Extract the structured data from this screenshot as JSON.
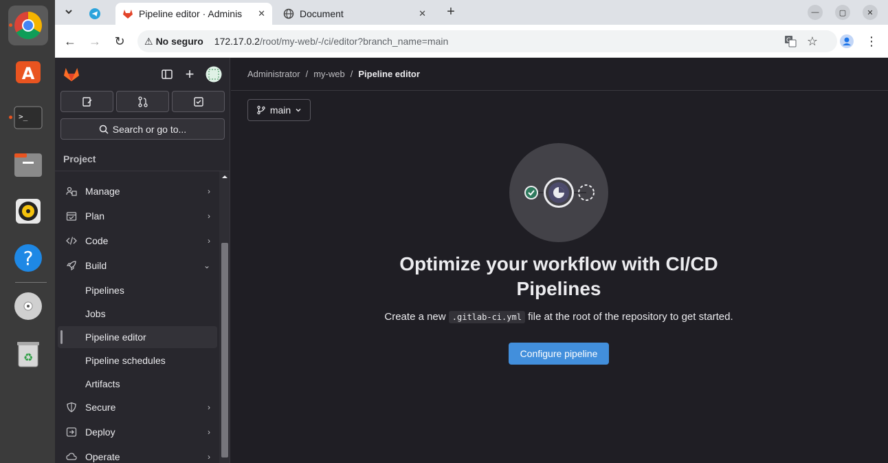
{
  "dock": {
    "apps": [
      "chrome",
      "telegram",
      "app-center",
      "terminal",
      "files",
      "rhythmbox",
      "help",
      "disc",
      "trash"
    ]
  },
  "browser": {
    "tabs": [
      {
        "title": "Pipeline editor · Adminis",
        "active": true
      },
      {
        "title": "Document",
        "active": false
      }
    ],
    "new_tab": "+",
    "omnibox": {
      "insecure_label": "No seguro",
      "url_host": "172.17.0.2",
      "url_path": "/root/my-web/-/ci/editor?branch_name=main"
    }
  },
  "sidebar": {
    "search_label": "Search or go to...",
    "section_label": "Project",
    "items": [
      {
        "label": "Manage",
        "icon": "users-icon"
      },
      {
        "label": "Plan",
        "icon": "calendar-icon"
      },
      {
        "label": "Code",
        "icon": "code-icon"
      },
      {
        "label": "Build",
        "icon": "rocket-icon"
      }
    ],
    "build_sub": [
      "Pipelines",
      "Jobs",
      "Pipeline editor",
      "Pipeline schedules",
      "Artifacts"
    ],
    "items_after": [
      {
        "label": "Secure",
        "icon": "shield-icon"
      },
      {
        "label": "Deploy",
        "icon": "deploy-icon"
      },
      {
        "label": "Operate",
        "icon": "cloud-icon"
      }
    ]
  },
  "main": {
    "breadcrumb": [
      "Administrator",
      "my-web",
      "Pipeline editor"
    ],
    "branch": "main",
    "empty_title": "Optimize your workflow with CI/CD Pipelines",
    "desc_before": "Create a new",
    "desc_code": ".gitlab-ci.yml",
    "desc_after": "file at the root of the repository to get started.",
    "configure_button": "Configure pipeline"
  },
  "colors": {
    "accent": "#428fdc",
    "sidebar_bg": "#28272d",
    "main_bg": "#1f1e24"
  }
}
